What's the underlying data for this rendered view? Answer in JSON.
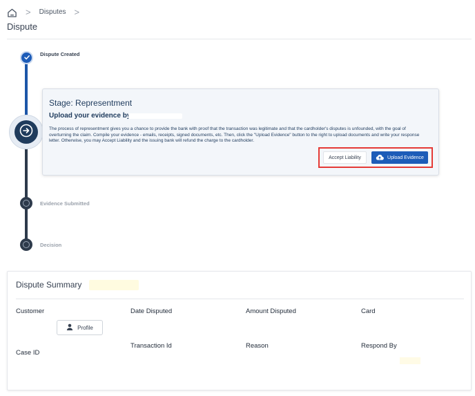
{
  "breadcrumb": {
    "separator": ">",
    "items": [
      {
        "label": "Disputes"
      }
    ],
    "trailing_separator": ">"
  },
  "page": {
    "title": "Dispute"
  },
  "timeline": {
    "steps": [
      {
        "label": "Dispute Created",
        "status": "done",
        "icon": "check-icon"
      },
      {
        "label": "Representment",
        "status": "current",
        "icon": "arrow-right-circle-icon"
      },
      {
        "label": "Evidence Submitted",
        "status": "pending",
        "icon": "circle-icon"
      },
      {
        "label": "Decision",
        "status": "pending",
        "icon": "circle-icon"
      }
    ]
  },
  "stage_card": {
    "title": "Stage: Representment",
    "heading": "Upload your evidence by",
    "description": "The process of representment gives you a chance to provide the bank with proof that the transaction was legitimate and that the cardholder's disputes is unfounded, with the goal of overturning the claim. Compile your evidence - emails, receipts, signed documents, etc. Then, click the \"Upload Evidence\" button to the right to upload documents and write your response letter. Otherwise, you may Accept Liability and the issuing bank will refund the charge to the cardholder.",
    "accept_label": "Accept Liability",
    "upload_label": "Upload Evidence",
    "upload_icon": "cloud-upload-icon"
  },
  "summary": {
    "title": "Dispute Summary",
    "fields": {
      "customer": "Customer",
      "date_disputed": "Date Disputed",
      "amount_disputed": "Amount Disputed",
      "card": "Card",
      "case_id": "Case ID",
      "transaction_id": "Transaction Id",
      "reason": "Reason",
      "respond_by": "Respond By"
    },
    "profile_label": "Profile",
    "profile_icon": "user-icon"
  },
  "colors": {
    "primary": "#1d5cb8",
    "timeline_dark": "#2d3a4b",
    "highlight": "#e53935"
  }
}
